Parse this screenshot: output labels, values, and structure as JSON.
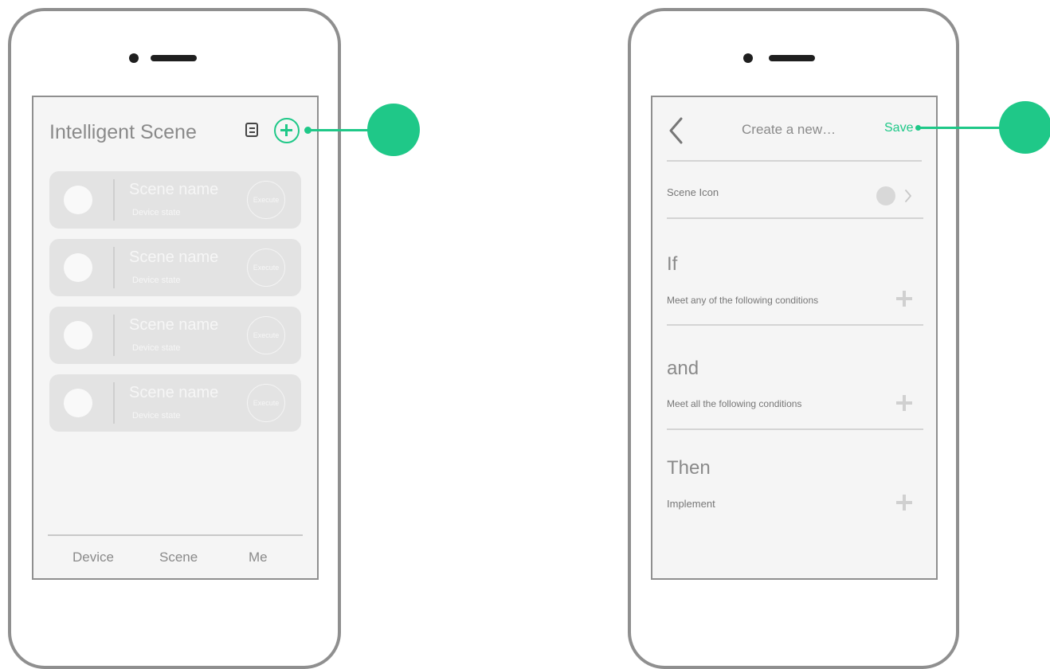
{
  "left": {
    "title": "Intelligent Scene",
    "scenes": [
      {
        "name": "Scene name",
        "state": "Device state",
        "button": "Execute"
      },
      {
        "name": "Scene name",
        "state": "Device state",
        "button": "Execute"
      },
      {
        "name": "Scene name",
        "state": "Device state",
        "button": "Execute"
      },
      {
        "name": "Scene name",
        "state": "Device state",
        "button": "Execute"
      }
    ],
    "tabs": [
      "Device",
      "Scene",
      "Me"
    ]
  },
  "right": {
    "header": {
      "title": "Create a new…",
      "save": "Save"
    },
    "scene_icon_label": "Scene Icon",
    "if": {
      "heading": "If",
      "subtitle": "Meet any of the following conditions"
    },
    "and": {
      "heading": "and",
      "subtitle": "Meet all the following conditions"
    },
    "then": {
      "heading": "Then",
      "subtitle": "Implement"
    }
  },
  "colors": {
    "accent": "#1fc888",
    "frame": "#8f8f8f",
    "card": "#e3e3e3",
    "screen_bg": "#f5f5f5"
  },
  "icons": [
    "list-icon",
    "add-circle-icon",
    "back-chevron-icon",
    "chevron-right-icon",
    "add-icon"
  ]
}
